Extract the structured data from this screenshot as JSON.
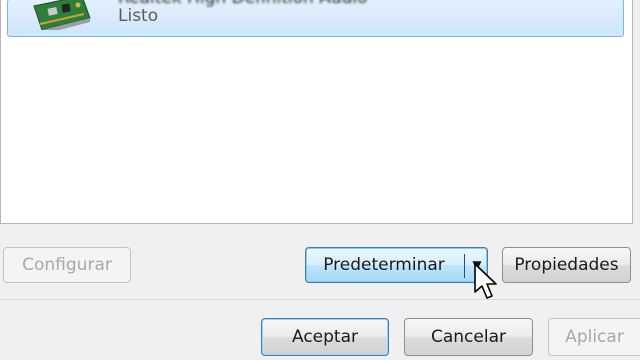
{
  "device": {
    "name": "Realtek High Definition Audio",
    "status": "Listo",
    "icon": "sound-card-icon"
  },
  "buttons": {
    "configure": "Configurar",
    "set_default": "Predeterminar",
    "set_default_arrow": "▼",
    "properties": "Propiedades",
    "ok": "Aceptar",
    "cancel": "Cancelar",
    "apply": "Aplicar"
  },
  "colors": {
    "selection_bg": "#cfe5fb",
    "selection_border": "#7fb3e6",
    "focus_border": "#3c7fb1"
  },
  "cursor": "arrow-pointer-icon"
}
